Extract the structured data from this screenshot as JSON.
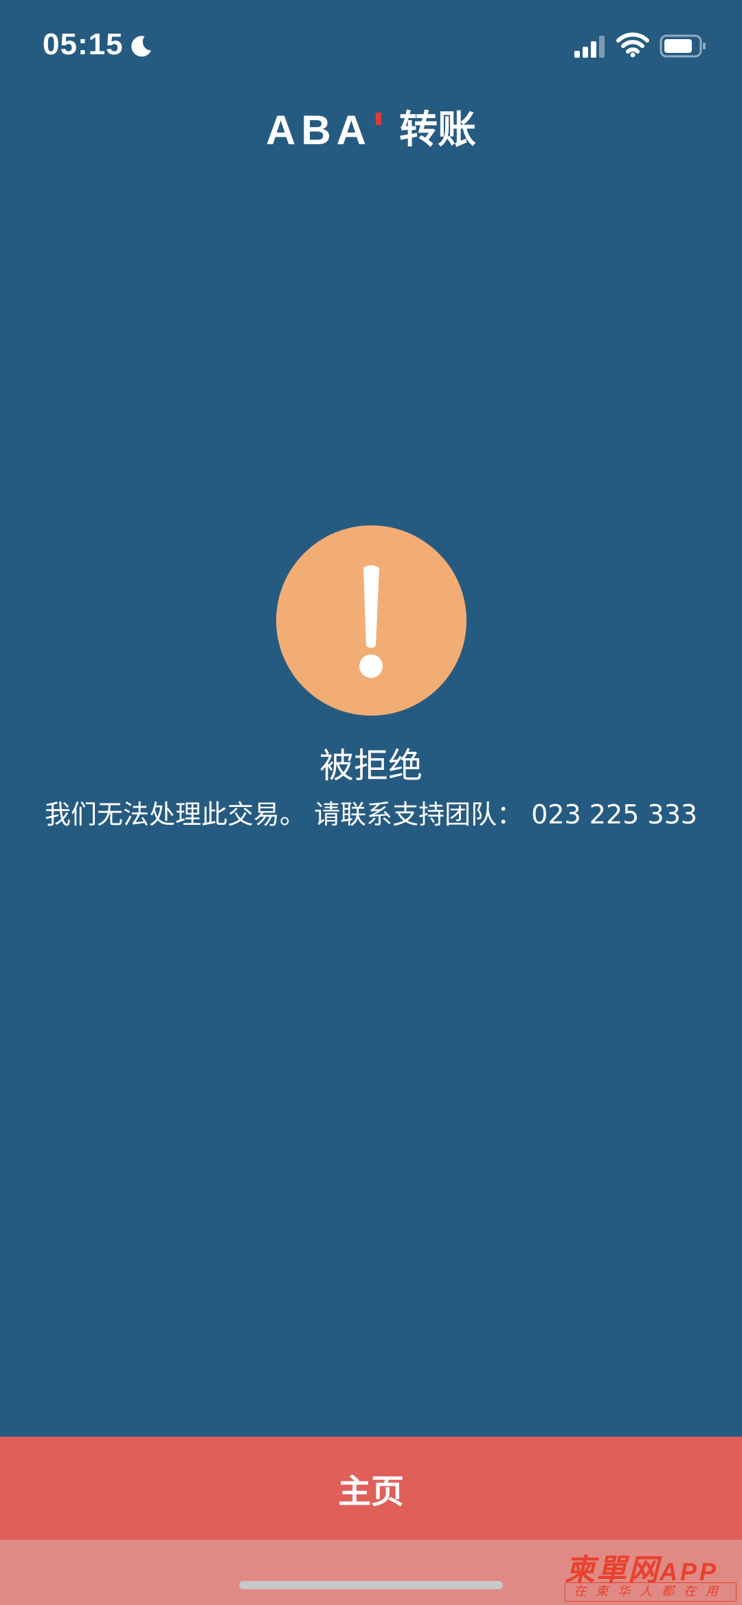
{
  "status_bar": {
    "time": "05:15",
    "icons": [
      "moon-icon",
      "signal-icon",
      "wifi-icon",
      "battery-icon"
    ]
  },
  "header": {
    "logo_text": "ABA",
    "title": "转账"
  },
  "result": {
    "icon": "exclamation-icon",
    "title": "被拒绝",
    "message": "我们无法处理此交易。 请联系支持团队： 023 225 333"
  },
  "home_button": {
    "label": "主页"
  },
  "watermark": {
    "main": "柬單网",
    "suffix": "APP",
    "sub": "在柬华人都在用"
  },
  "colors": {
    "background": "#265b81",
    "alert_circle": "#f2ad74",
    "home_button": "#e05f59",
    "logo_mark": "#e03a3a"
  }
}
